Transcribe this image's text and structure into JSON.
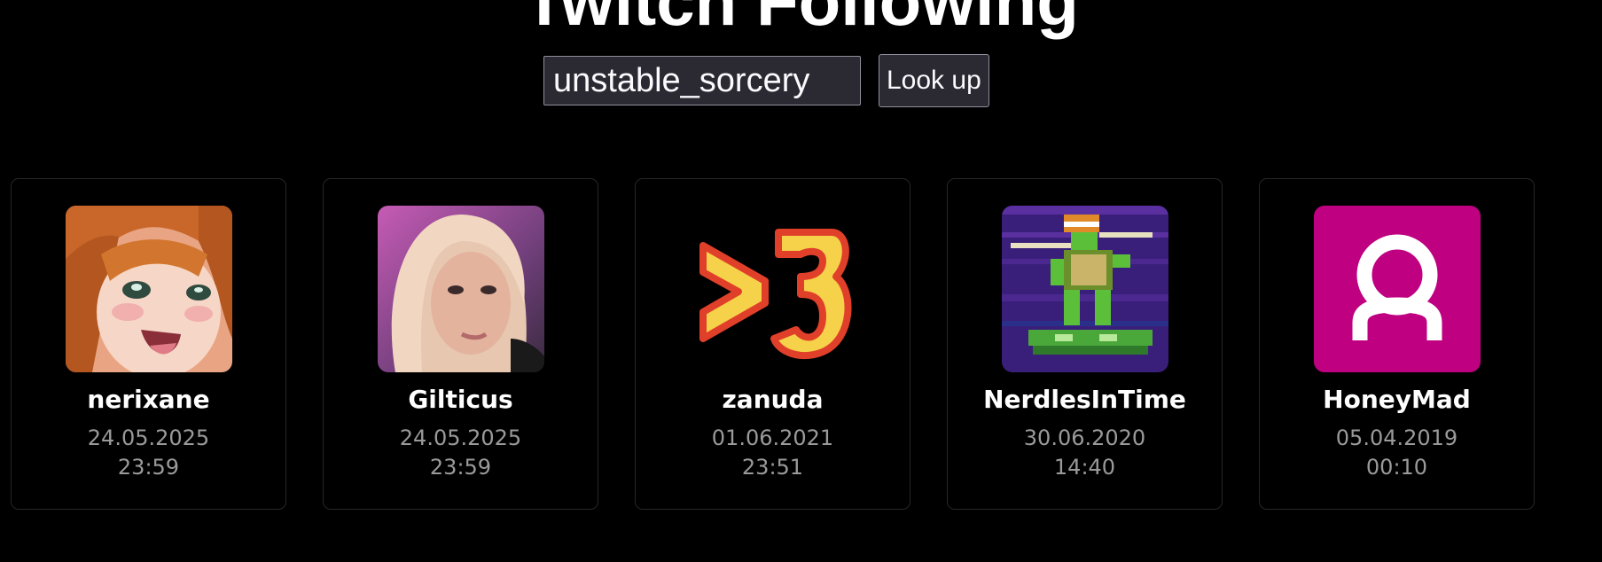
{
  "page_title": "Twitch Following",
  "search": {
    "value": "unstable_sorcery",
    "button_label": "Look up"
  },
  "follows": [
    {
      "name": "nerixane",
      "date": "24.05.2025",
      "time": "23:59",
      "avatar": "anime-girl-avatar"
    },
    {
      "name": "Gilticus",
      "date": "24.05.2025",
      "time": "23:59",
      "avatar": "photo-blonde-avatar"
    },
    {
      "name": "zanuda",
      "date": "01.06.2021",
      "time": "23:51",
      "avatar": "greater-than-3-logo-avatar"
    },
    {
      "name": "NerdlesInTime",
      "date": "30.06.2020",
      "time": "14:40",
      "avatar": "pixel-turtle-avatar"
    },
    {
      "name": "HoneyMad",
      "date": "05.04.2019",
      "time": "00:10",
      "avatar": "default-user-icon"
    }
  ],
  "colors": {
    "background": "#000000",
    "card_border": "#262626",
    "input_bg": "#2b2a33",
    "muted_text": "#9a9a9a",
    "default_avatar_bg": "#bf0080"
  }
}
